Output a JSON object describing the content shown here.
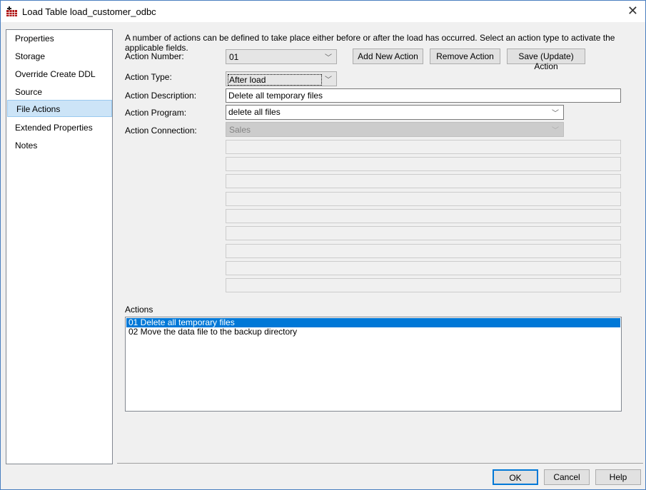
{
  "window": {
    "title": "Load Table load_customer_odbc",
    "close": "✕"
  },
  "sidebar": {
    "items": [
      {
        "label": "Properties"
      },
      {
        "label": "Storage"
      },
      {
        "label": "Override Create DDL"
      },
      {
        "label": "Source"
      },
      {
        "label": "File Actions"
      },
      {
        "label": "Extended Properties"
      },
      {
        "label": "Notes"
      }
    ],
    "selected": "File Actions"
  },
  "main": {
    "intro": "A number of actions can be defined to take place either before or after the load has occurred. Select an action type to activate the applicable fields.",
    "action_number_label": "Action Number:",
    "action_number": "01",
    "add_button": "Add New Action",
    "remove_button": "Remove Action",
    "save_button": "Save (Update) Action",
    "action_type_label": "Action Type:",
    "action_type": "After load",
    "action_description_label": "Action Description:",
    "action_description": "Delete all temporary files",
    "action_program_label": "Action Program:",
    "action_program": "delete all files",
    "action_connection_label": "Action Connection:",
    "action_connection": "Sales",
    "actions_label": "Actions",
    "actions": [
      "01 Delete all temporary files",
      "02 Move the data file to the backup directory"
    ]
  },
  "footer": {
    "ok": "OK",
    "cancel": "Cancel",
    "help": "Help"
  }
}
